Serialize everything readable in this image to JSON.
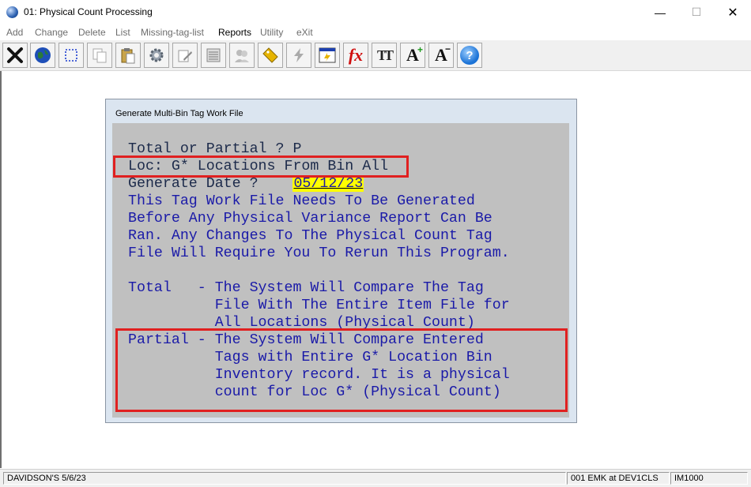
{
  "window": {
    "title": "01: Physical Count Processing",
    "controls": {
      "minimize": "—",
      "maximize": "☐",
      "close": "✕"
    }
  },
  "menu": [
    {
      "label": "Add",
      "active": false
    },
    {
      "label": "Change",
      "active": false
    },
    {
      "label": "Delete",
      "active": false
    },
    {
      "label": "List",
      "active": false
    },
    {
      "label": "Missing-tag-list",
      "active": false
    },
    {
      "label": "Reports",
      "active": true
    },
    {
      "label": "Utility",
      "active": false
    },
    {
      "label": "eXit",
      "active": false
    }
  ],
  "toolbar": {
    "icons": [
      "exit-x-icon",
      "globe-icon",
      "select-rect-icon",
      "copy-icon",
      "paste-icon",
      "settings-gear-icon",
      "edit-icon",
      "list-view-icon",
      "users-icon",
      "tag-icon",
      "lightning-icon",
      "calculator-icon",
      "function-icon",
      "text-format-icon",
      "font-increase-icon",
      "font-decrease-icon",
      "help-icon"
    ],
    "function_label": "fx",
    "text_format_label": "TT",
    "font_up_label": "A",
    "font_down_label": "A",
    "help_label": "?"
  },
  "dialog": {
    "title": "Generate Multi-Bin Tag Work File",
    "line_total_partial": "Total or Partial ? P",
    "line_loc": "Loc: G* Locations From Bin All",
    "line_generate_label": "Generate Date ?    ",
    "generate_date": "05/12/23",
    "paragraph": [
      "This Tag Work File Needs To Be Generated",
      "Before Any Physical Variance Report Can Be",
      "Ran. Any Changes To The Physical Count Tag",
      "File Will Require You To Rerun This Program."
    ],
    "total_desc": [
      "Total   - The System Will Compare The Tag",
      "          File With The Entire Item File for",
      "          All Locations (Physical Count)"
    ],
    "partial_desc": [
      "Partial - The System Will Compare Entered",
      "          Tags with Entire G* Location Bin",
      "          Inventory record. It is a physical",
      "          count for Loc G* (Physical Count)"
    ]
  },
  "status": {
    "left": "DAVIDSON'S 5/6/23",
    "user": "001 EMK at DEV1CLS",
    "program": "IM1000"
  }
}
